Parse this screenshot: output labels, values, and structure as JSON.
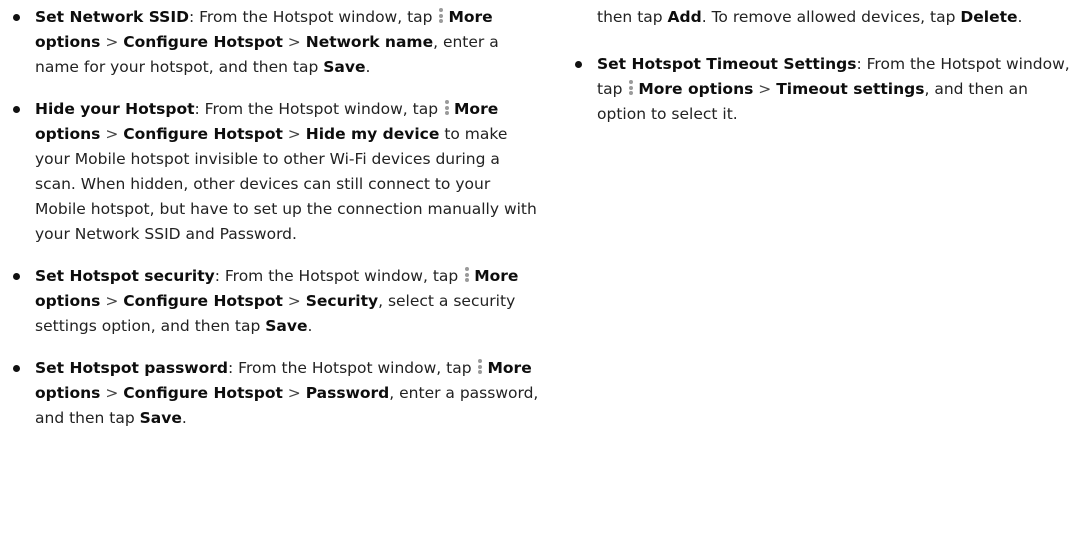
{
  "left": {
    "items": [
      {
        "title": "Set Network SSID",
        "t1": ": From the Hotspot window, tap ",
        "more": "More options",
        "sep1": " > ",
        "configure": "Configure Hotspot",
        "sep2": " > ",
        "setting": "Network name",
        "t2": ", enter a name for your hotspot, and then tap ",
        "save": "Save",
        "end": "."
      },
      {
        "title": "Hide your Hotspot",
        "t1": ": From the Hotspot window, tap ",
        "more": "More options",
        "sep1": " > ",
        "configure": "Configure Hotspot",
        "sep2": " > ",
        "setting": "Hide my device",
        "t2": " to make your Mobile hotspot invisible to other Wi-Fi devices during a scan. When hidden, other devices can still connect to your Mobile hotspot, but have to set up the connection manually with your Network SSID and Password."
      },
      {
        "title": "Set Hotspot security",
        "t1": ": From the Hotspot window, tap ",
        "more": "More options",
        "sep1": " > ",
        "configure": "Configure Hotspot",
        "sep2": " > ",
        "setting": "Security",
        "t2": ", select a security settings option, and then tap ",
        "save": "Save",
        "end": "."
      },
      {
        "title": "Set Hotspot password",
        "t1": ": From the Hotspot window, tap ",
        "more": "More options",
        "sep1": " > ",
        "configure": "Configure Hotspot",
        "sep2": " > ",
        "setting": "Password",
        "t2": ", enter a password, and then tap ",
        "save": "Save",
        "end": "."
      }
    ]
  },
  "right": {
    "continued": {
      "t1": "then tap ",
      "add": "Add",
      "t2": ". To remove allowed devices, tap ",
      "delete": "Delete",
      "end": "."
    },
    "item": {
      "title": "Set Hotspot Timeout Settings",
      "t1": ": From the Hotspot window, tap ",
      "more": "More options",
      "sep1": " > ",
      "setting": "Timeout settings",
      "t2": ", and then an option to select it."
    }
  }
}
